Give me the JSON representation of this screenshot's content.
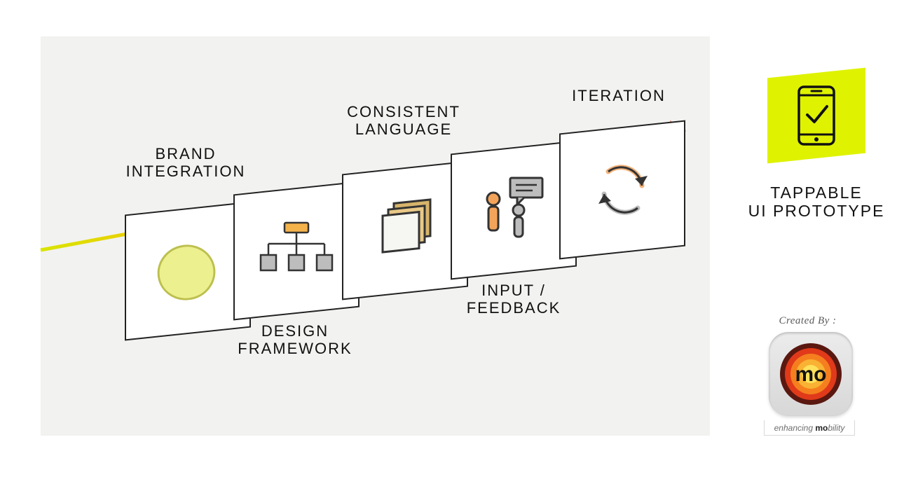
{
  "steps": [
    {
      "label_line1": "BRAND",
      "label_line2": "INTEGRATION",
      "label_pos": "above",
      "icon": "brand-circle"
    },
    {
      "label_line1": "DESIGN",
      "label_line2": "FRAMEWORK",
      "label_pos": "below",
      "icon": "org-chart"
    },
    {
      "label_line1": "CONSISTENT",
      "label_line2": "LANGUAGE",
      "label_pos": "above",
      "icon": "layers"
    },
    {
      "label_line1": "INPUT /",
      "label_line2": "FEEDBACK",
      "label_pos": "below",
      "icon": "people-chat"
    },
    {
      "label_line1": "ITERATION",
      "label_line2": "",
      "label_pos": "above",
      "icon": "cycle"
    }
  ],
  "result": {
    "line1": "TAPPABLE",
    "line2": "UI PROTOTYPE",
    "icon": "phone-check"
  },
  "attribution": {
    "heading": "Created By :",
    "logo_text": "mo",
    "tagline_prefix": "enhancing ",
    "tagline_bold": "mo",
    "tagline_suffix": "bility"
  },
  "colors": {
    "arrow_gradient": [
      "#d9e400",
      "#f5c200",
      "#f59a00",
      "#ef6a1f",
      "#e23b1a"
    ],
    "accent_tile": "#dff200"
  }
}
